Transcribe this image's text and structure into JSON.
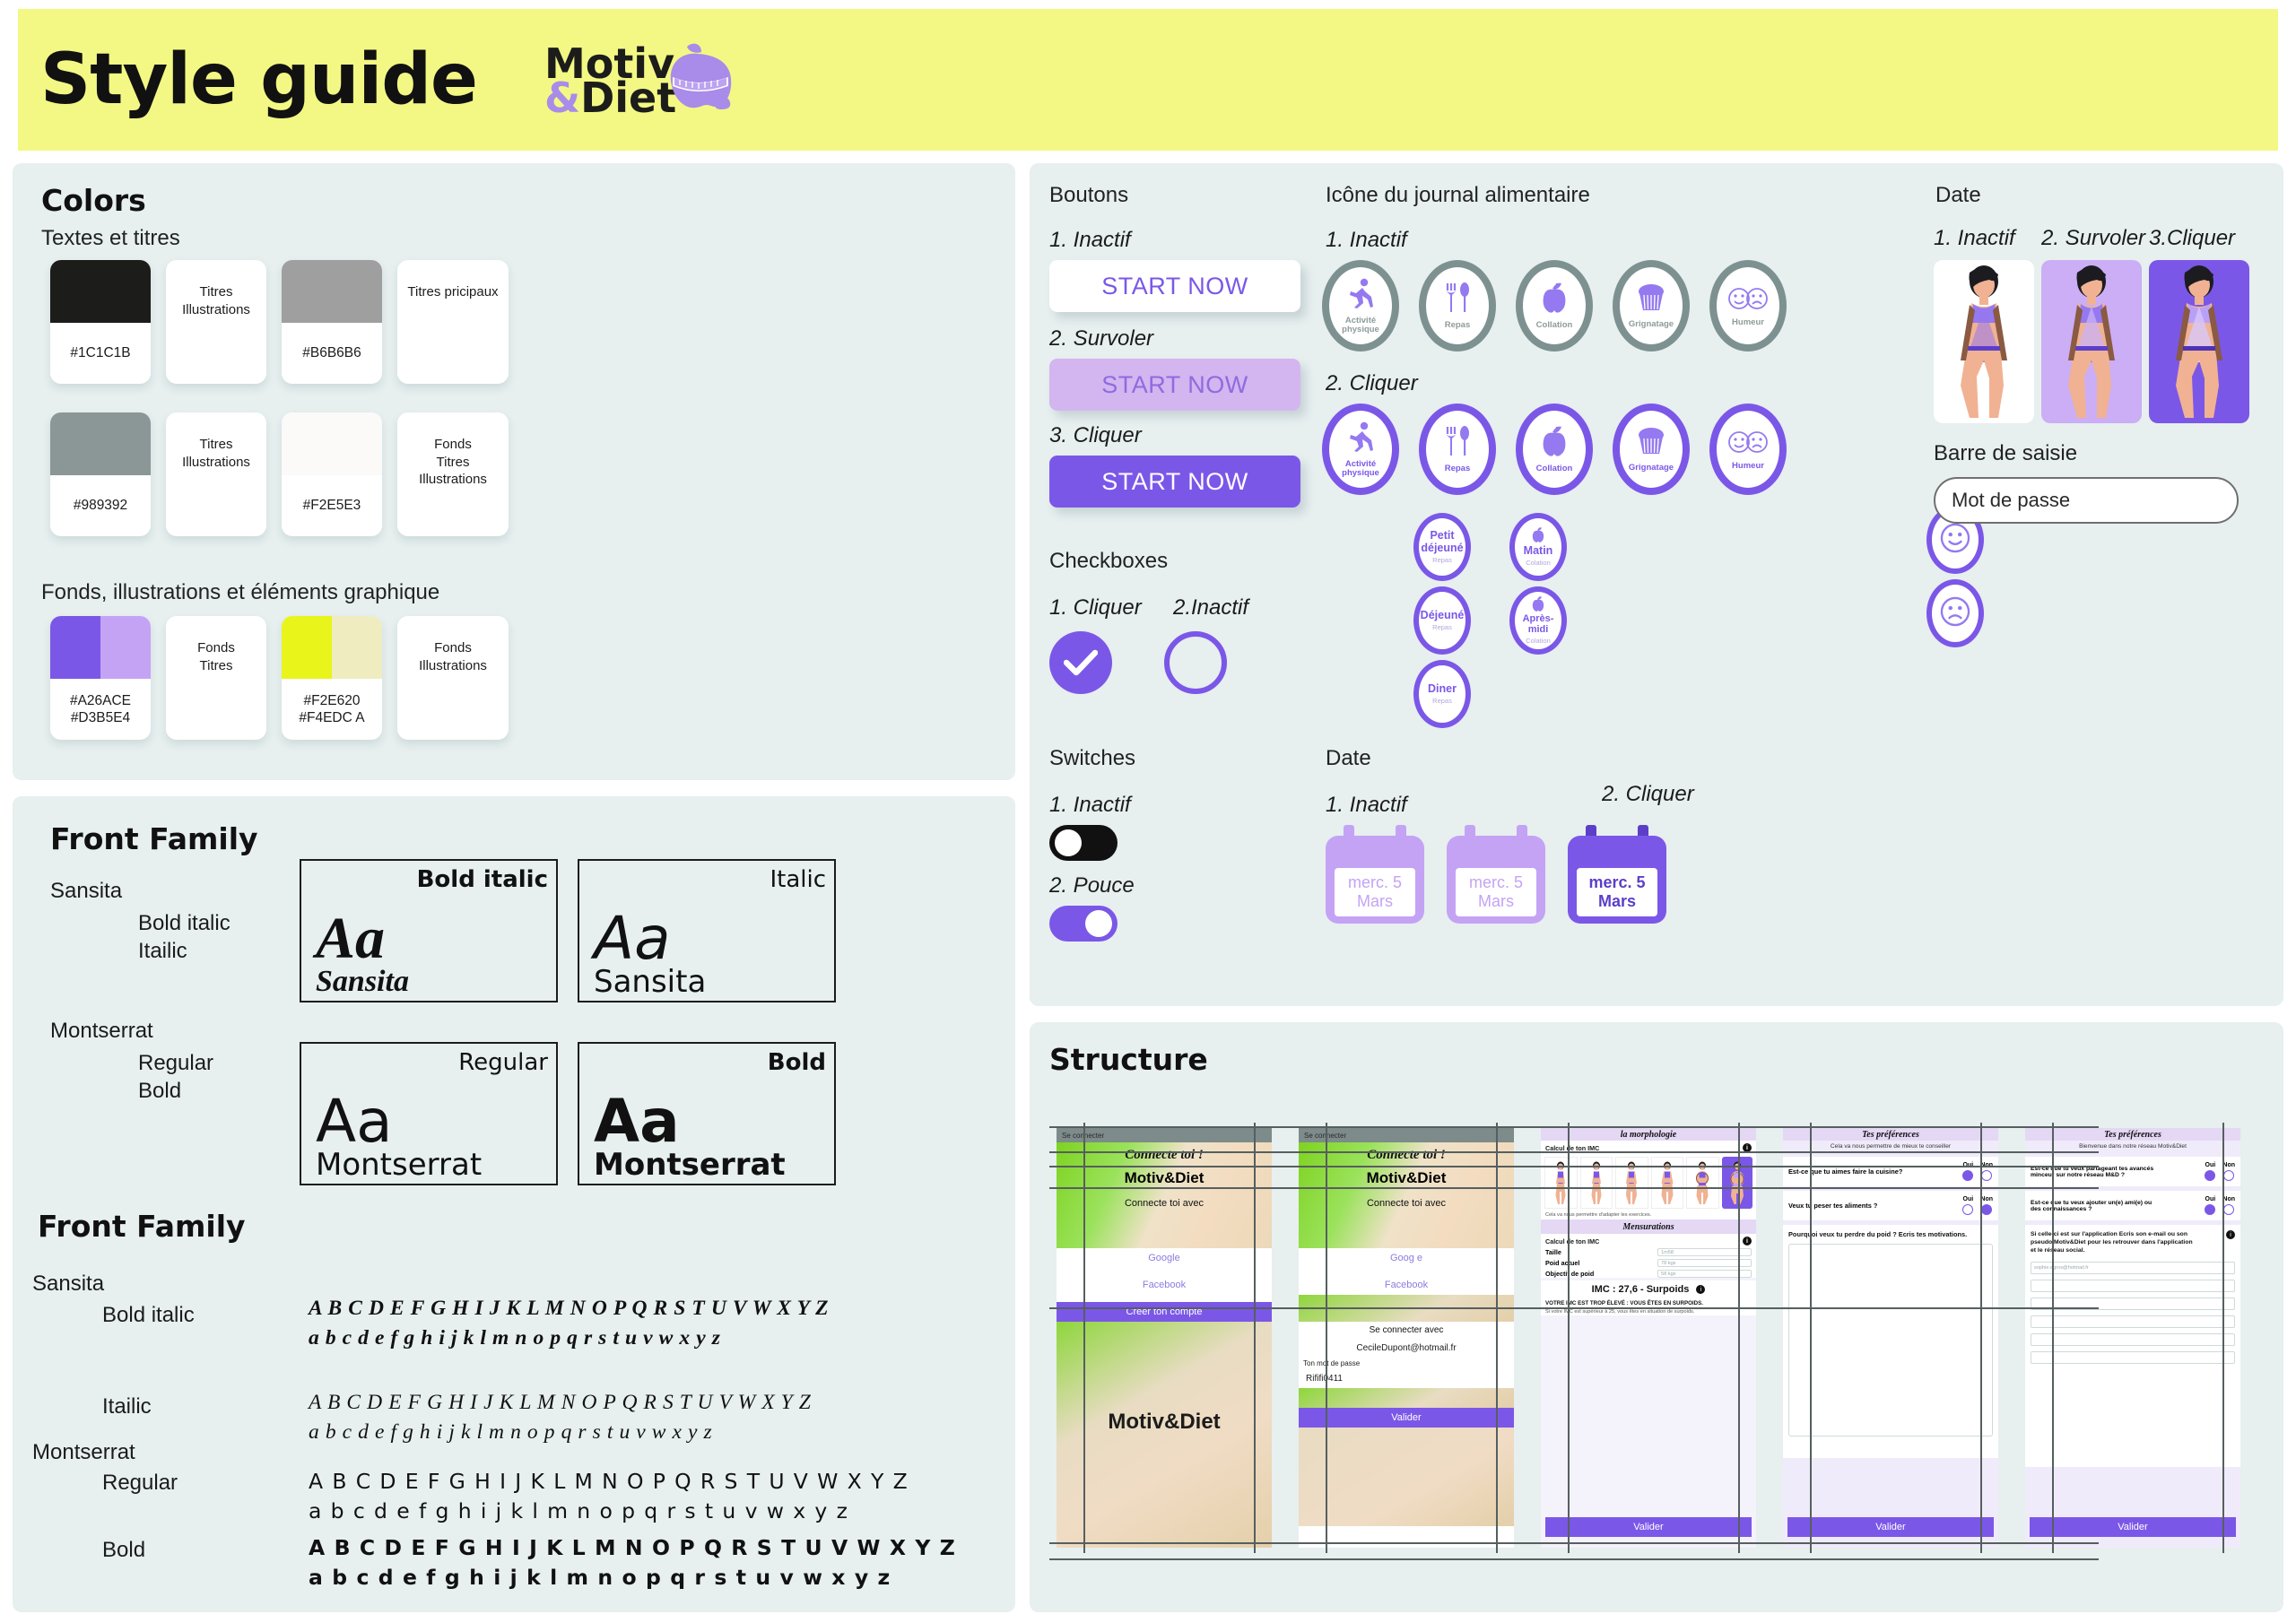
{
  "header": {
    "title": "Style guide",
    "logo": {
      "motiv": "Motiv",
      "amp": "&",
      "diet": "Diet",
      "icon": "apple-measuring-tape-logo"
    }
  },
  "colors": {
    "heading": "Colors",
    "group1_label": "Textes et titres",
    "group2_label": "Fonds, illustrations et éléments graphique",
    "group1": [
      {
        "type": "swatch",
        "hex": "#1C1C1B",
        "label": "#1C1C1B",
        "fills": [
          "#1C1C1B"
        ]
      },
      {
        "type": "note",
        "label": "Titres\nIllustrations"
      },
      {
        "type": "swatch",
        "hex": "#B6B6B6",
        "label": "#B6B6B6",
        "fills": [
          "#9F9F9F"
        ]
      },
      {
        "type": "note",
        "label": "Titres pricipaux"
      },
      {
        "type": "swatch",
        "hex": "#989392",
        "label": "#989392",
        "fills": [
          "#8A9796"
        ]
      },
      {
        "type": "note",
        "label": "Titres\nIllustrations"
      },
      {
        "type": "swatch",
        "hex": "#F2E5E3",
        "label": "#F2E5E3",
        "fills": [
          "#FBFAF9"
        ]
      },
      {
        "type": "note",
        "label": "Fonds\nTitres\nIllustrations"
      }
    ],
    "group2": [
      {
        "type": "swatch",
        "label": "#A26ACE\n#D3B5E4",
        "fills": [
          "#7B57E8",
          "#C4A3F5"
        ]
      },
      {
        "type": "note",
        "label": "Fonds\nTitres"
      },
      {
        "type": "swatch",
        "label": "#F2E620\n#F4EDC A",
        "fills": [
          "#E9F41A",
          "#EFECC0"
        ]
      },
      {
        "type": "note",
        "label": "Fonds\nIllustrations"
      }
    ]
  },
  "fonts": {
    "heading_top": "Front Family",
    "heading_bottom": "Front Family",
    "families": [
      {
        "name": "Sansita",
        "weights": [
          "Bold italic",
          "Itailic"
        ]
      },
      {
        "name": "Montserrat",
        "weights": [
          "Regular",
          "Bold"
        ]
      }
    ],
    "specimens": [
      {
        "tag": "Bold italic",
        "aa": "Aa",
        "name": "Sansita",
        "style": "serif-i"
      },
      {
        "tag": "Italic",
        "aa": "Aa",
        "name": "Sansita",
        "style": "sans-r"
      },
      {
        "tag": "Regular",
        "aa": "Aa",
        "name": "Montserrat",
        "style": "sans-r"
      },
      {
        "tag": "Bold",
        "aa": "Aa",
        "name": "Montserrat",
        "style": "sans-b"
      }
    ],
    "alphabets": [
      {
        "family": "Sansita",
        "weight": "Bold italic",
        "upper": "A B C D E F G H I J K L M N O P Q R S T U V W X Y Z",
        "lower": "a b c d e f g h i j k l m n o p q r s t u v w x y z"
      },
      {
        "family": "",
        "weight": "Itailic",
        "upper": "A B C D E F G H I J K L M N O P Q R S T U V W X Y Z",
        "lower": "a b c d e f g h i j k l m n o p q r s t u v w x y z"
      },
      {
        "family": "Montserrat",
        "weight": "Regular",
        "upper": "A B C D E F G H I J K L M N O P Q R S T U V W X Y Z",
        "lower": "a b c d e f g h i j k l m n o p q r s t u v w x y z"
      },
      {
        "family": "",
        "weight": "Bold",
        "upper": "A B C D E F G H I J K L M N O P Q R S T U V W X Y Z",
        "lower": "a b c d e f g h i j k l m n o p q r s t u v w x y z"
      }
    ]
  },
  "buttons": {
    "heading": "Boutons",
    "states": [
      {
        "state": "1. Inactif",
        "label": "START NOW"
      },
      {
        "state": "2. Survoler",
        "label": "START NOW"
      },
      {
        "state": "3. Cliquer",
        "label": "START NOW"
      }
    ]
  },
  "checkboxes": {
    "heading": "Checkboxes",
    "states": [
      "1. Cliquer",
      "2.Inactif"
    ]
  },
  "switches": {
    "heading": "Switches",
    "states": [
      "1. Inactif",
      "2. Pouce"
    ]
  },
  "journal": {
    "heading": "Icône du journal alimentaire",
    "state_inactive": "1. Inactif",
    "state_active": "2. Cliquer",
    "icons": [
      {
        "icon": "running-person-icon",
        "glyph": "🏃",
        "caption": "Activité\nphysique"
      },
      {
        "icon": "fork-spoon-icon",
        "glyph": "🍴",
        "caption": "Repas"
      },
      {
        "icon": "apple-icon",
        "glyph": "🍎",
        "caption": "Collation"
      },
      {
        "icon": "cupcake-icon",
        "glyph": "🧁",
        "caption": "Grignatage"
      },
      {
        "icon": "mood-faces-icon",
        "glyph": "☺☹",
        "caption": "Humeur"
      }
    ],
    "sub_repas": [
      {
        "title": "Petit déjeuné",
        "sub": "Repas"
      },
      {
        "title": "Déjeuné",
        "sub": "Repas"
      },
      {
        "title": "Diner",
        "sub": "Repas"
      }
    ],
    "sub_collation": [
      {
        "title": "Matin",
        "sub": "Colation",
        "icon": "apple-icon"
      },
      {
        "title": "Après-midi",
        "sub": "Colation",
        "icon": "apple-icon"
      }
    ],
    "sub_humeur": [
      {
        "icon": "smiley-happy-icon",
        "glyph": "☺"
      },
      {
        "icon": "smiley-sad-icon",
        "glyph": "☹"
      }
    ]
  },
  "date_figures": {
    "heading": "Date",
    "states": [
      "1. Inactif",
      "2. Survoler",
      "3.Cliquer"
    ],
    "backgrounds": [
      "#FFFFFF",
      "#CBAEF5",
      "#7B57E8"
    ],
    "figure": "female-body-measurement-illustration"
  },
  "input": {
    "heading": "Barre de saisie",
    "placeholder": "Mot de passe",
    "value": "Mot de passe"
  },
  "date_picker": {
    "heading": "Date",
    "states": [
      "1. Inactif",
      "2. Cliquer"
    ],
    "items": [
      {
        "day": "merc. 5",
        "month": "Mars",
        "state": "inactive"
      },
      {
        "day": "merc. 5",
        "month": "Mars",
        "state": "inactive"
      },
      {
        "day": "merc. 5",
        "month": "Mars",
        "state": "active"
      }
    ]
  },
  "structure": {
    "heading": "Structure",
    "screens": [
      {
        "topbar": "Se connecter",
        "title": "Connecte toi !",
        "logo": "Motiv&Diet",
        "subtitle": "Connecte toi avec",
        "fields": [
          "Google",
          "Facebook"
        ],
        "button": "Créer ton compte",
        "footer_logo": "Motiv&Diet"
      },
      {
        "topbar": "Se connecter",
        "title": "Connecte toi !",
        "logo": "Motiv&Diet",
        "subtitle": "Connecte toi avec",
        "fields": [
          "Goog e",
          "Facebook"
        ],
        "subtitle2": "Se connecter avec",
        "email": "CecileDupont@hotmail.fr",
        "password_label": "Ton mot de passe",
        "password": "Rififi0411",
        "button": "Valider"
      },
      {
        "header": "la morphologie",
        "section1": "Calcul de ton IMC",
        "hint": "Cela va nous permettre d'adapter les exercices.",
        "section2": "Mensurations",
        "section3": "Calcul de ton IMC",
        "rows": [
          {
            "label": "Taille",
            "value": "1m58"
          },
          {
            "label": "Poid actuel",
            "value": "78 kgs"
          },
          {
            "label": "Objectif de poid",
            "value": "58 kgs"
          }
        ],
        "result": "IMC : 27,6 - Surpoids",
        "warning": "VOTRE IMC EST TROP ÉLEVÉ : VOUS ÊTES EN SURPOIDS.",
        "warning_sub": "Si votre IMC est supérieur à 25, vous êtes en situation de surpoids.",
        "button": "Valider"
      },
      {
        "header": "Tes préférences",
        "hint": "Cela va nous permettre de mieux te conseiller",
        "questions": [
          {
            "q": "Est-ce que tu aimes faire la cuisine?",
            "yes": "Oui",
            "no": "Non",
            "answer": "oui"
          },
          {
            "q": "Veux tu peser tes aliments ?",
            "yes": "Oui",
            "no": "Non",
            "answer": "non"
          }
        ],
        "open_q": "Pourquoi veux tu perdre du poid ? Ecris tes motivations.",
        "button": "Valider"
      },
      {
        "header": "Tes préférences",
        "hint": "Bienvenue dans notre réseau Motiv&Diet",
        "questions": [
          {
            "q": "Est-ce que tu veux partageant tes avancés minceur sur notre réseau M&D ?",
            "yes": "Oui",
            "no": "Non",
            "answer": "oui"
          },
          {
            "q": "Est-ce que tu veux ajouter un(e) ami(e) ou des connaissances ?",
            "yes": "Oui",
            "no": "Non",
            "answer": "oui"
          }
        ],
        "note": "Si celle-ci est sur l'application Ecris son e-mail ou son pseudo Motiv&Diet pour les retrouver dans l'application et le réseau social.",
        "email_placeholder": "sophie.egros@hotmail.fr",
        "button": "Valider"
      }
    ]
  },
  "palette": {
    "purple": "#7B57E8",
    "purple_light": "#C4A3F5",
    "grey_green": "#7D9290",
    "panel_bg": "#E7EFEF",
    "header_yellow": "#F3F884",
    "black": "#1C1C1B"
  }
}
